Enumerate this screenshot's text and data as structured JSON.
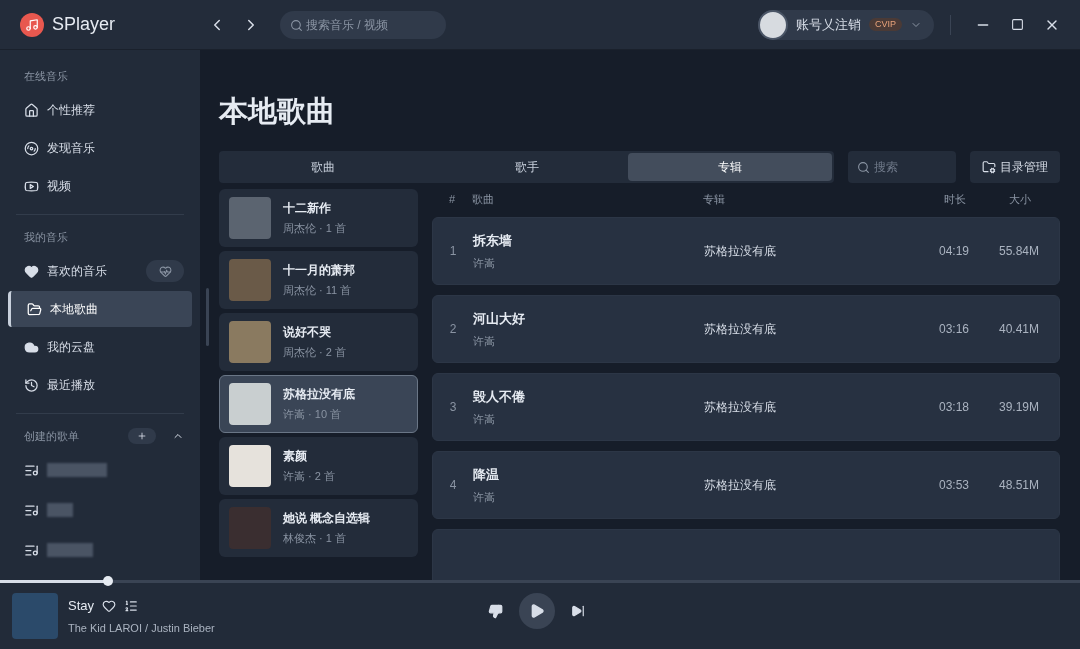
{
  "app": {
    "name": "SPlayer"
  },
  "header": {
    "search_placeholder": "搜索音乐 / 视频",
    "user": {
      "name": "账号乂注销",
      "badge": "CVIP"
    }
  },
  "sidebar": {
    "sections": [
      {
        "title": "在线音乐",
        "items": [
          {
            "label": "个性推荐",
            "selected": false
          },
          {
            "label": "发现音乐",
            "selected": false
          },
          {
            "label": "视频",
            "selected": false
          }
        ]
      },
      {
        "title": "我的音乐",
        "items": [
          {
            "label": "喜欢的音乐",
            "selected": false,
            "heartbeat_button": true
          },
          {
            "label": "本地歌曲",
            "selected": true
          },
          {
            "label": "我的云盘",
            "selected": false
          },
          {
            "label": "最近播放",
            "selected": false
          }
        ]
      },
      {
        "title": "创建的歌单",
        "expanded": true,
        "playlists": [
          {
            "kind": "blurred"
          },
          {
            "kind": "blurred"
          },
          {
            "kind": "blurred"
          }
        ]
      }
    ]
  },
  "page": {
    "title": "本地歌曲",
    "tabs": [
      {
        "label": "歌曲",
        "selected": false
      },
      {
        "label": "歌手",
        "selected": false
      },
      {
        "label": "专辑",
        "selected": true
      }
    ],
    "search_placeholder": "搜索",
    "manage_button": "目录管理"
  },
  "albums": [
    {
      "title": "十二新作",
      "subtitle": "周杰伦 · 1 首",
      "selected": false
    },
    {
      "title": "十一月的萧邦",
      "subtitle": "周杰伦 · 11 首",
      "selected": false
    },
    {
      "title": "说好不哭",
      "subtitle": "周杰伦 · 2 首",
      "selected": false
    },
    {
      "title": "苏格拉没有底",
      "subtitle": "许嵩 · 10 首",
      "selected": true
    },
    {
      "title": "素颜",
      "subtitle": "许嵩 · 2 首",
      "selected": false
    },
    {
      "title": "她说 概念自选辑",
      "subtitle": "林俊杰 · 1 首",
      "selected": false
    }
  ],
  "songs": {
    "columns": [
      "#",
      "歌曲",
      "专辑",
      "时长",
      "大小"
    ],
    "rows": [
      {
        "index": "1",
        "title": "拆东墙",
        "artist": "许嵩",
        "album": "苏格拉没有底",
        "duration": "04:19",
        "size": "55.84M"
      },
      {
        "index": "2",
        "title": "河山大好",
        "artist": "许嵩",
        "album": "苏格拉没有底",
        "duration": "03:16",
        "size": "40.41M"
      },
      {
        "index": "3",
        "title": "毁人不倦",
        "artist": "许嵩",
        "album": "苏格拉没有底",
        "duration": "03:18",
        "size": "39.19M"
      },
      {
        "index": "4",
        "title": "降温",
        "artist": "许嵩",
        "album": "苏格拉没有底",
        "duration": "03:53",
        "size": "48.51M"
      }
    ]
  },
  "player": {
    "title": "Stay",
    "artist": "The Kid LAROI / Justin Bieber",
    "level": 0.1
  }
}
